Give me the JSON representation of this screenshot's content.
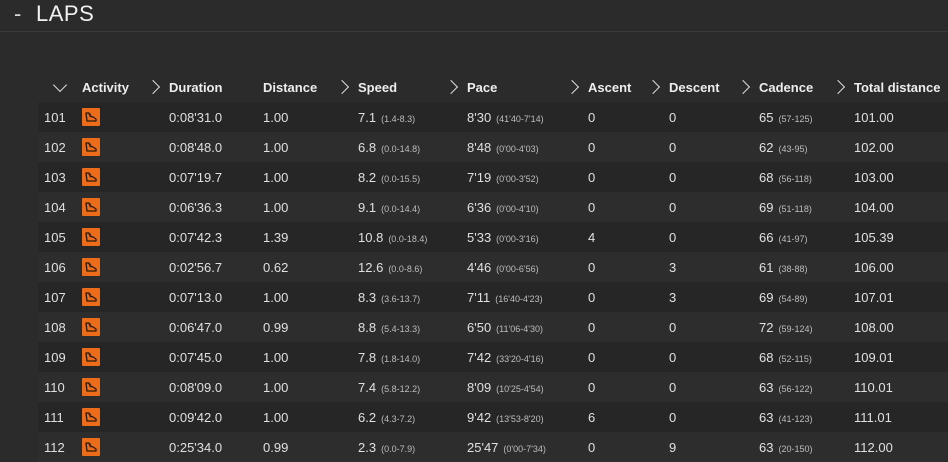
{
  "section": {
    "title": "LAPS",
    "collapse_glyph": "-"
  },
  "columns": {
    "activity": "Activity",
    "duration": "Duration",
    "distance": "Distance",
    "speed": "Speed",
    "pace": "Pace",
    "ascent": "Ascent",
    "descent": "Descent",
    "cadence": "Cadence",
    "total_distance": "Total distance"
  },
  "icons": {
    "activity": "running-shoe-icon",
    "activity_color": "#ec6c1a"
  },
  "rows": [
    {
      "lap": "101",
      "duration": "0:08'31.0",
      "distance": "1.00",
      "speed": "7.1",
      "speed_range": "(1.4-8.3)",
      "pace": "8'30",
      "pace_range": "(41'40-7'14)",
      "ascent": "0",
      "descent": "0",
      "cadence": "65",
      "cadence_range": "(57-125)",
      "total": "101.00"
    },
    {
      "lap": "102",
      "duration": "0:08'48.0",
      "distance": "1.00",
      "speed": "6.8",
      "speed_range": "(0.0-14.8)",
      "pace": "8'48",
      "pace_range": "(0'00-4'03)",
      "ascent": "0",
      "descent": "0",
      "cadence": "62",
      "cadence_range": "(43-95)",
      "total": "102.00"
    },
    {
      "lap": "103",
      "duration": "0:07'19.7",
      "distance": "1.00",
      "speed": "8.2",
      "speed_range": "(0.0-15.5)",
      "pace": "7'19",
      "pace_range": "(0'00-3'52)",
      "ascent": "0",
      "descent": "0",
      "cadence": "68",
      "cadence_range": "(56-118)",
      "total": "103.00"
    },
    {
      "lap": "104",
      "duration": "0:06'36.3",
      "distance": "1.00",
      "speed": "9.1",
      "speed_range": "(0.0-14.4)",
      "pace": "6'36",
      "pace_range": "(0'00-4'10)",
      "ascent": "0",
      "descent": "0",
      "cadence": "69",
      "cadence_range": "(51-118)",
      "total": "104.00"
    },
    {
      "lap": "105",
      "duration": "0:07'42.3",
      "distance": "1.39",
      "speed": "10.8",
      "speed_range": "(0.0-18.4)",
      "pace": "5'33",
      "pace_range": "(0'00-3'16)",
      "ascent": "4",
      "descent": "0",
      "cadence": "66",
      "cadence_range": "(41-97)",
      "total": "105.39"
    },
    {
      "lap": "106",
      "duration": "0:02'56.7",
      "distance": "0.62",
      "speed": "12.6",
      "speed_range": "(0.0-8.6)",
      "pace": "4'46",
      "pace_range": "(0'00-6'56)",
      "ascent": "0",
      "descent": "3",
      "cadence": "61",
      "cadence_range": "(38-88)",
      "total": "106.00"
    },
    {
      "lap": "107",
      "duration": "0:07'13.0",
      "distance": "1.00",
      "speed": "8.3",
      "speed_range": "(3.6-13.7)",
      "pace": "7'11",
      "pace_range": "(16'40-4'23)",
      "ascent": "0",
      "descent": "3",
      "cadence": "69",
      "cadence_range": "(54-89)",
      "total": "107.01"
    },
    {
      "lap": "108",
      "duration": "0:06'47.0",
      "distance": "0.99",
      "speed": "8.8",
      "speed_range": "(5.4-13.3)",
      "pace": "6'50",
      "pace_range": "(11'06-4'30)",
      "ascent": "0",
      "descent": "0",
      "cadence": "72",
      "cadence_range": "(59-124)",
      "total": "108.00"
    },
    {
      "lap": "109",
      "duration": "0:07'45.0",
      "distance": "1.00",
      "speed": "7.8",
      "speed_range": "(1.8-14.0)",
      "pace": "7'42",
      "pace_range": "(33'20-4'16)",
      "ascent": "0",
      "descent": "0",
      "cadence": "68",
      "cadence_range": "(52-115)",
      "total": "109.01"
    },
    {
      "lap": "110",
      "duration": "0:08'09.0",
      "distance": "1.00",
      "speed": "7.4",
      "speed_range": "(5.8-12.2)",
      "pace": "8'09",
      "pace_range": "(10'25-4'54)",
      "ascent": "0",
      "descent": "0",
      "cadence": "63",
      "cadence_range": "(56-122)",
      "total": "110.01"
    },
    {
      "lap": "111",
      "duration": "0:09'42.0",
      "distance": "1.00",
      "speed": "6.2",
      "speed_range": "(4.3-7.2)",
      "pace": "9'42",
      "pace_range": "(13'53-8'20)",
      "ascent": "6",
      "descent": "0",
      "cadence": "63",
      "cadence_range": "(41-123)",
      "total": "111.01"
    },
    {
      "lap": "112",
      "duration": "0:25'34.0",
      "distance": "0.99",
      "speed": "2.3",
      "speed_range": "(0.0-7.9)",
      "pace": "25'47",
      "pace_range": "(0'00-7'34)",
      "ascent": "0",
      "descent": "9",
      "cadence": "63",
      "cadence_range": "(20-150)",
      "total": "112.00"
    }
  ]
}
